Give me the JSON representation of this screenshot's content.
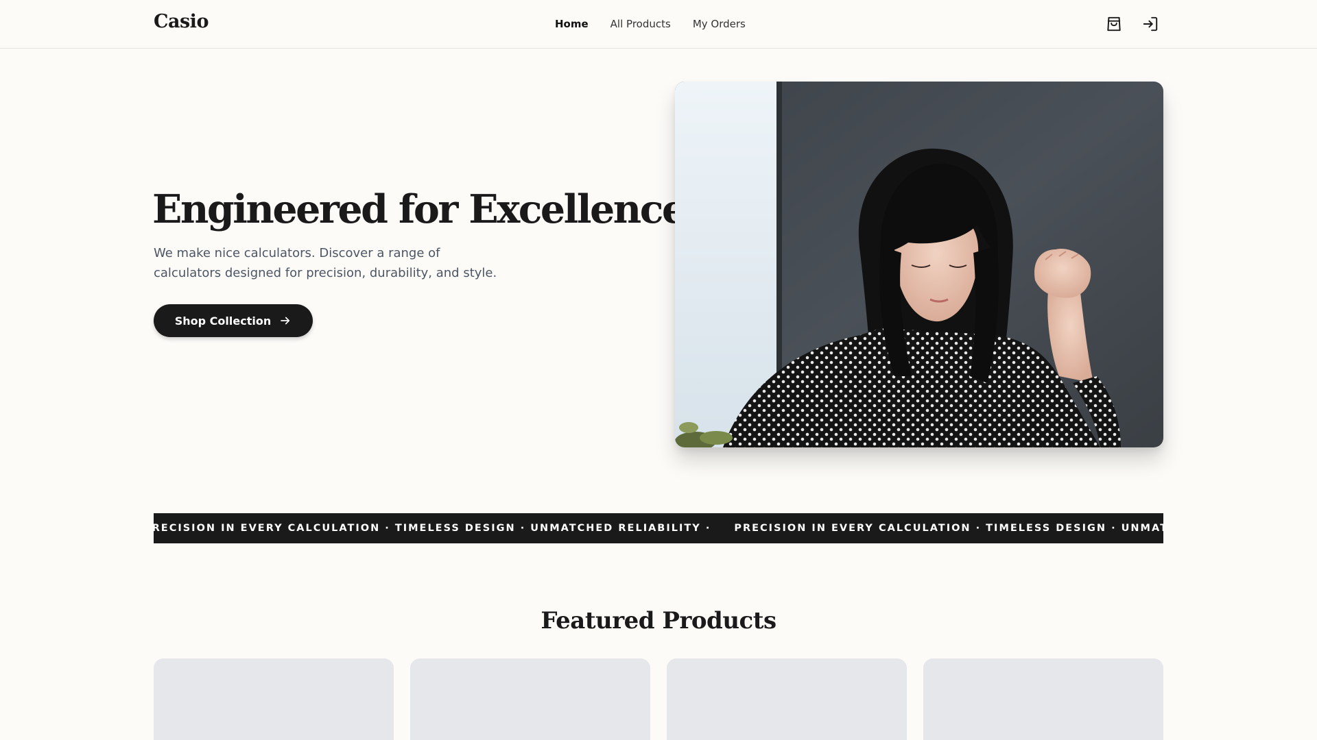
{
  "header": {
    "logo": "Casio",
    "nav": [
      {
        "label": "Home",
        "active": true
      },
      {
        "label": "All Products",
        "active": false
      },
      {
        "label": "My Orders",
        "active": false
      }
    ],
    "icons": [
      "shopping-bag-icon",
      "sign-in-icon"
    ]
  },
  "hero": {
    "title": "Engineered for Excellence.",
    "description": "We make nice calculators. Discover a range of calculators designed for precision, durability, and style.",
    "cta_label": "Shop Collection",
    "image_alt": "woman in polka-dot shirt working at a desk"
  },
  "marquee": {
    "text": "PRECISION IN EVERY CALCULATION · TIMELESS DESIGN · UNMATCHED RELIABILITY ·"
  },
  "featured": {
    "title": "Featured Products",
    "card_count": 4
  },
  "colors": {
    "background": "#fcfbf8",
    "primary": "#1a1a1a",
    "muted_text": "#4b5563",
    "card_placeholder": "#e5e7eb"
  }
}
